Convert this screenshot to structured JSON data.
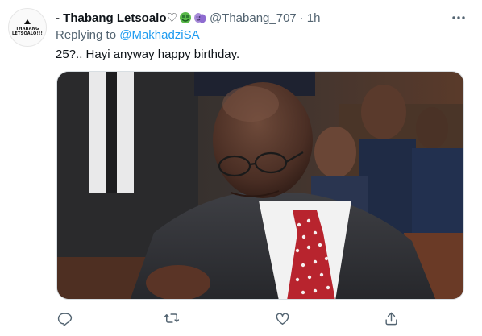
{
  "tweet": {
    "author": {
      "display_name": "- Thabang Letsoalo♡",
      "handle": "@Thabang_707",
      "avatar_text": [
        "THABANG",
        "LETSOALO!!!"
      ]
    },
    "time": "1h",
    "separator": "·",
    "reply_prefix": "Replying to",
    "reply_to": "@MakhadziSA",
    "text": "25?.. Hayi anyway happy birthday.",
    "media": {
      "description_icon": "photo-of-man-in-suit-and-red-polka-dot-tie"
    },
    "icons": {
      "header": [
        "money-face-emoji",
        "performing-arts-emoji",
        "more-icon"
      ],
      "actions": [
        "reply-icon",
        "retweet-icon",
        "like-icon",
        "share-icon"
      ]
    },
    "colors": {
      "link": "#1d9bf0",
      "secondary_text": "#536471",
      "primary_text": "#0f1419"
    }
  }
}
